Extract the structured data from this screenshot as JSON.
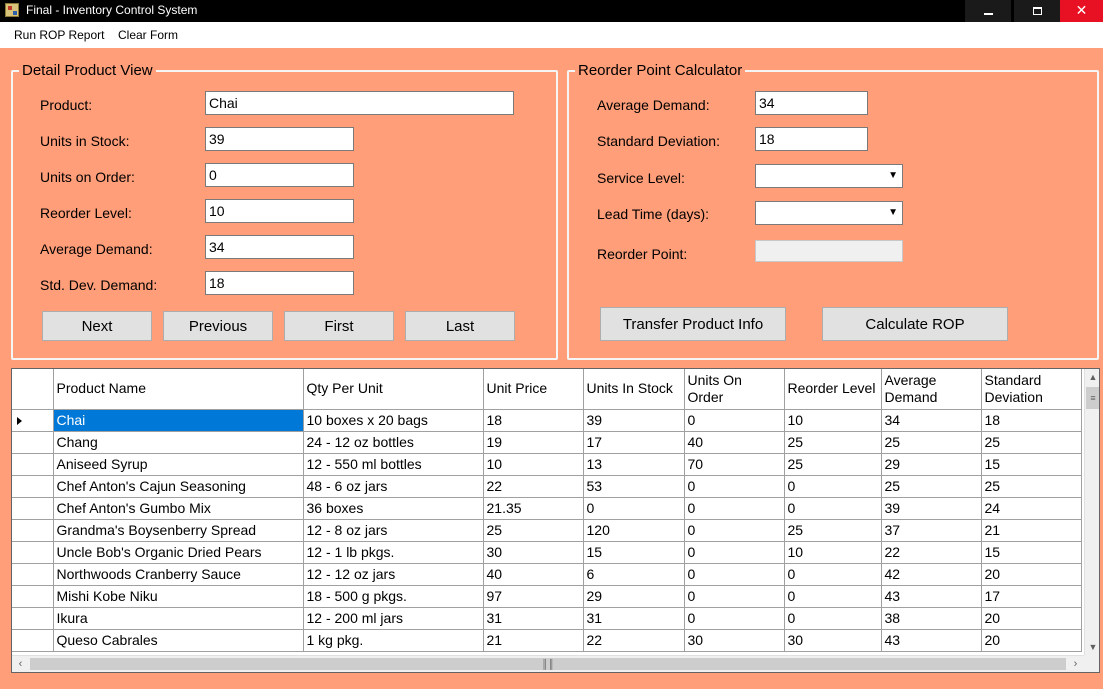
{
  "window": {
    "title": "Final - Inventory Control System",
    "minimize_glyph": "",
    "close_glyph": "✕"
  },
  "menu": {
    "run_rop_report": "Run ROP Report",
    "clear_form": "Clear Form"
  },
  "detail": {
    "group_title": "Detail Product View",
    "product_label": "Product:",
    "product_value": "Chai",
    "units_in_stock_label": "Units in Stock:",
    "units_in_stock_value": "39",
    "units_on_order_label": "Units on Order:",
    "units_on_order_value": "0",
    "reorder_level_label": "Reorder Level:",
    "reorder_level_value": "10",
    "average_demand_label": "Average Demand:",
    "average_demand_value": "34",
    "std_dev_label": "Std. Dev. Demand:",
    "std_dev_value": "18",
    "next_label": "Next",
    "previous_label": "Previous",
    "first_label": "First",
    "last_label": "Last"
  },
  "rop": {
    "group_title": "Reorder Point Calculator",
    "average_demand_label": "Average Demand:",
    "average_demand_value": "34",
    "std_dev_label": "Standard Deviation:",
    "std_dev_value": "18",
    "service_level_label": "Service Level:",
    "service_level_value": "",
    "lead_time_label": "Lead Time (days):",
    "lead_time_value": "",
    "reorder_point_label": "Reorder Point:",
    "reorder_point_value": "",
    "transfer_label": "Transfer Product Info",
    "calculate_label": "Calculate ROP"
  },
  "grid": {
    "columns": [
      "Product Name",
      "Qty Per Unit",
      "Unit Price",
      "Units In Stock",
      "Units On Order",
      "Reorder Level",
      "Average Demand",
      "Standard Deviation"
    ],
    "rows": [
      [
        "Chai",
        "10 boxes x 20 bags",
        "18",
        "39",
        "0",
        "10",
        "34",
        "18"
      ],
      [
        "Chang",
        "24 - 12 oz bottles",
        "19",
        "17",
        "40",
        "25",
        "25",
        "25"
      ],
      [
        "Aniseed Syrup",
        "12 - 550 ml bottles",
        "10",
        "13",
        "70",
        "25",
        "29",
        "15"
      ],
      [
        "Chef Anton's Cajun Seasoning",
        "48 - 6 oz jars",
        "22",
        "53",
        "0",
        "0",
        "25",
        "25"
      ],
      [
        "Chef Anton's Gumbo Mix",
        "36 boxes",
        "21.35",
        "0",
        "0",
        "0",
        "39",
        "24"
      ],
      [
        "Grandma's Boysenberry Spread",
        "12 - 8 oz jars",
        "25",
        "120",
        "0",
        "25",
        "37",
        "21"
      ],
      [
        "Uncle Bob's Organic Dried Pears",
        "12 - 1 lb pkgs.",
        "30",
        "15",
        "0",
        "10",
        "22",
        "15"
      ],
      [
        "Northwoods Cranberry Sauce",
        "12 - 12 oz jars",
        "40",
        "6",
        "0",
        "0",
        "42",
        "20"
      ],
      [
        "Mishi Kobe Niku",
        "18 - 500 g pkgs.",
        "97",
        "29",
        "0",
        "0",
        "43",
        "17"
      ],
      [
        "Ikura",
        "12 - 200 ml jars",
        "31",
        "31",
        "0",
        "0",
        "38",
        "20"
      ],
      [
        "Queso Cabrales",
        "1 kg pkg.",
        "21",
        "22",
        "30",
        "30",
        "43",
        "20"
      ]
    ],
    "selected_row": 0
  },
  "colors": {
    "form_background": "#ff9e79",
    "selection": "#0078d7",
    "close_button": "#e81123"
  }
}
